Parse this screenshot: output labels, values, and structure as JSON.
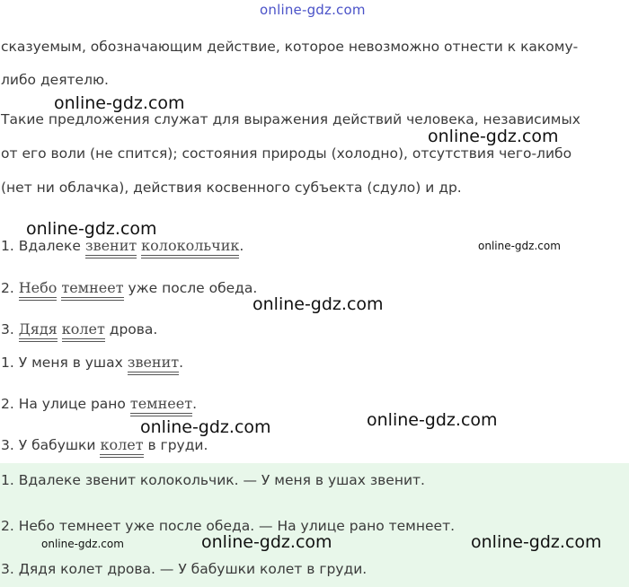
{
  "watermark": "online-gdz.com",
  "theory": {
    "line1": "сказуемым, обозначающим действие, которое невозможно отнести к какому-",
    "line2": "либо деятелю.",
    "line3": "Такие предложения служат для выражения действий человека, независимых",
    "line4": "от его воли (не спится); состояния природы (холодно), отсутствия чего-либо",
    "line5": "(нет ни облачка), действия косвенного субъекта (сдуло) и др."
  },
  "sentences_group1": [
    {
      "num": "1. Вдалеке ",
      "pred1": "звенит",
      "mid": " ",
      "pred2": "колокольчик",
      "end": "."
    },
    {
      "num": "2. ",
      "pred1": "Небо",
      "mid": " ",
      "pred2": "темнеет",
      "end": " уже после обеда."
    },
    {
      "num": "3. ",
      "pred1": "Дядя",
      "mid": " ",
      "pred2": "колет",
      "end": " дрова."
    }
  ],
  "sentences_group2": [
    {
      "start": "1. У меня в ушах ",
      "pred": "звенит",
      "end": "."
    },
    {
      "start": "2. На улице рано ",
      "pred": "темнеет",
      "end": "."
    },
    {
      "start": "3. У бабушки ",
      "pred": "колет",
      "end": " в груди."
    }
  ],
  "answer": {
    "line1": "1. Вдалеке звенит колокольчик. — У меня в ушах звенит.",
    "line2": "2. Небо темнеет уже после обеда. — На улице рано темнеет.",
    "line3": "3. Дядя колет дрова. — У бабушки колет в груди."
  },
  "colors": {
    "answer_bg": "#e8f7ea",
    "top_watermark": "#4a52c8"
  }
}
